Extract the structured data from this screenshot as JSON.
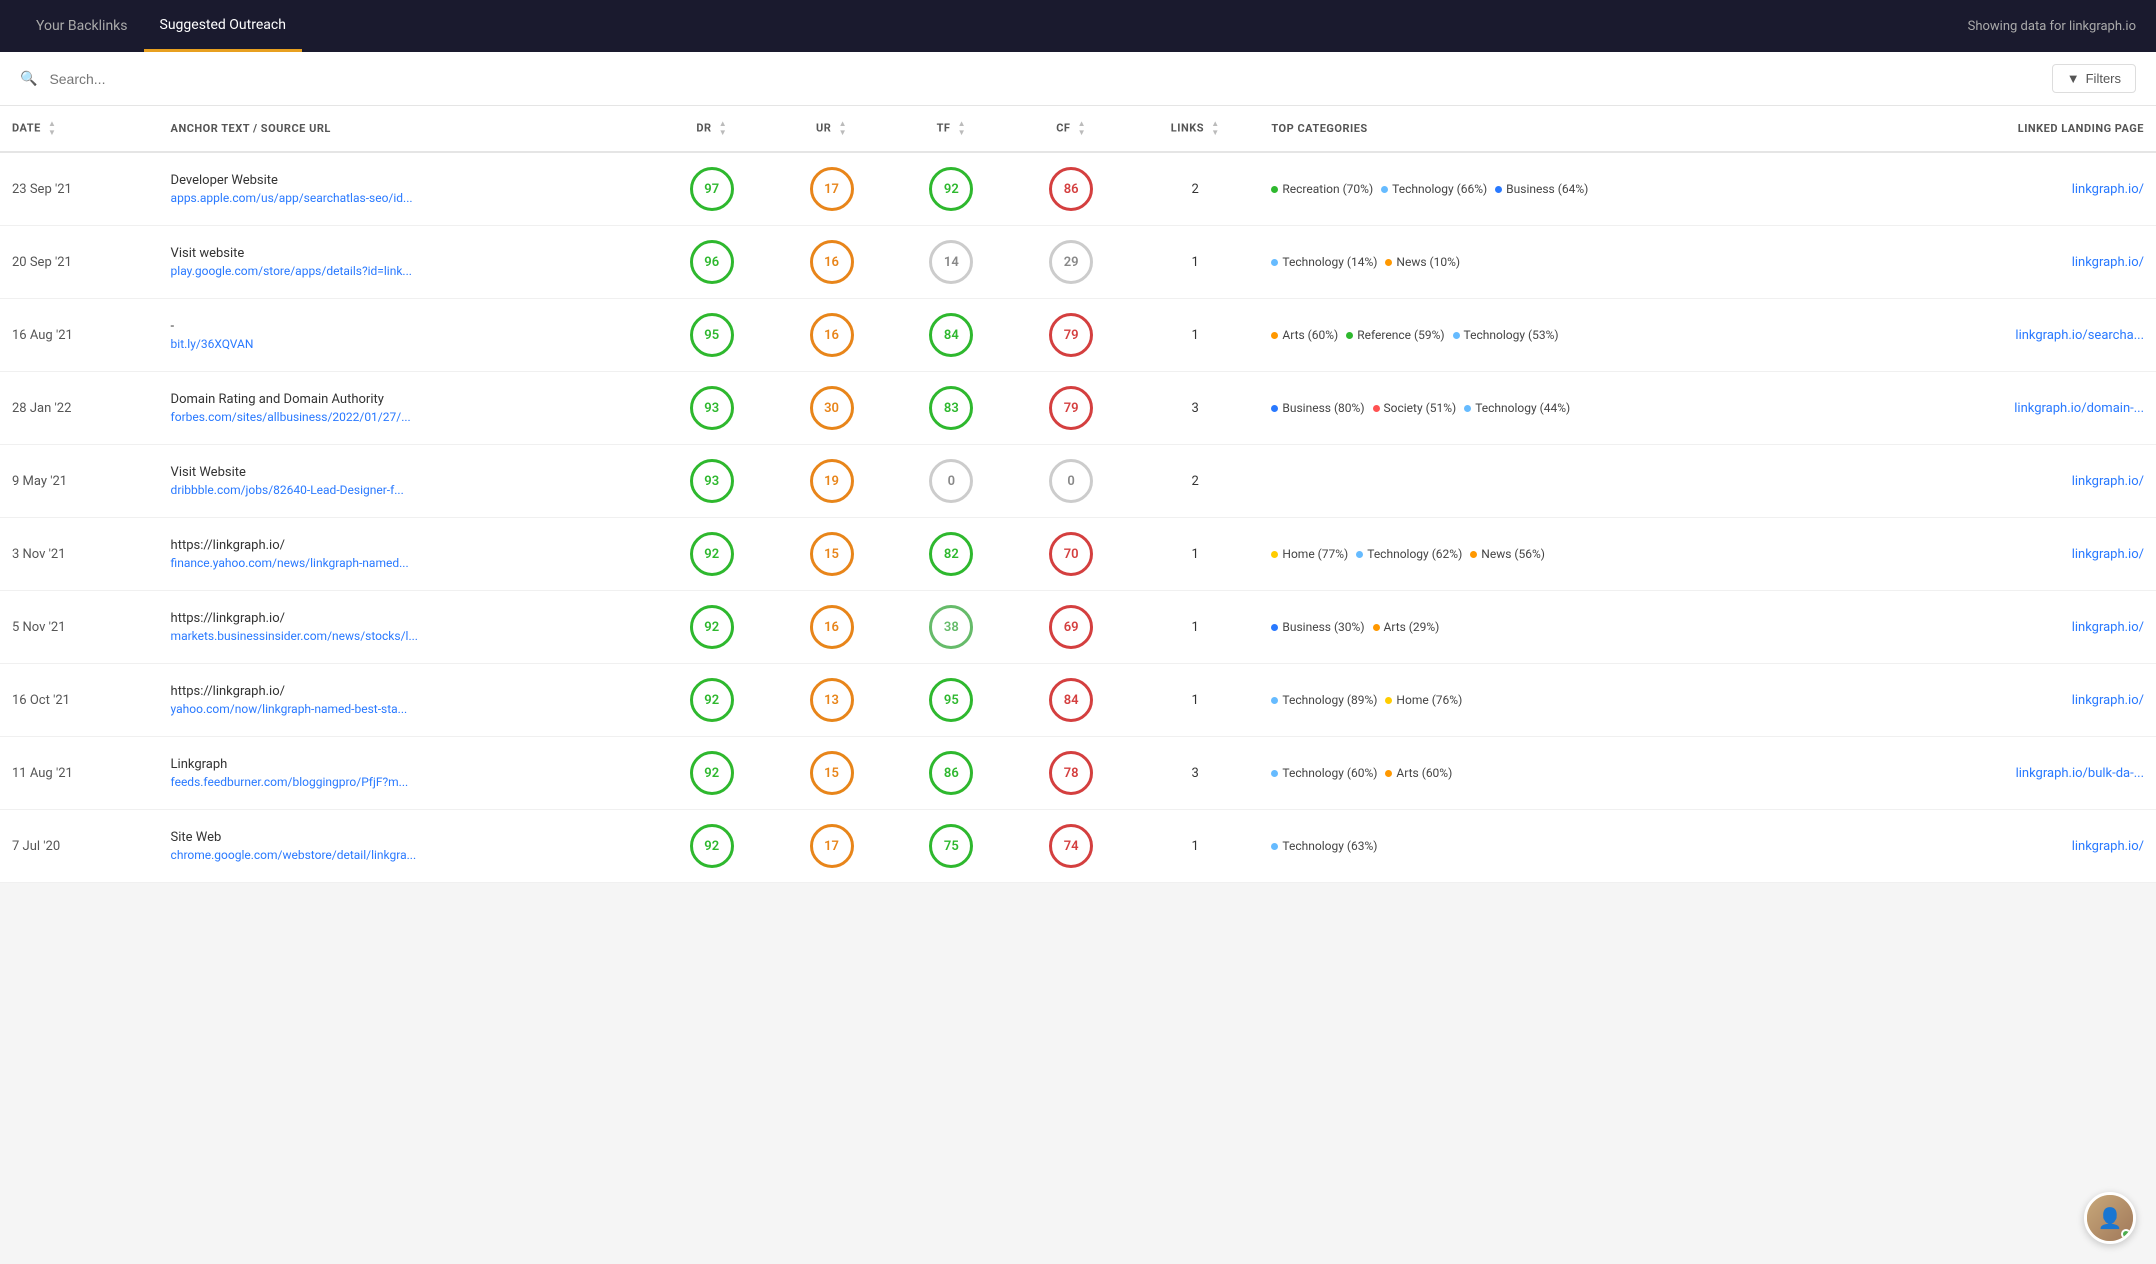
{
  "nav": {
    "tabs": [
      {
        "id": "your-backlinks",
        "label": "Your Backlinks",
        "active": false
      },
      {
        "id": "suggested-outreach",
        "label": "Suggested Outreach",
        "active": true
      }
    ],
    "showing_data": "Showing data for linkgraph.io"
  },
  "search": {
    "placeholder": "Search...",
    "filters_label": "Filters"
  },
  "table": {
    "columns": [
      {
        "id": "date",
        "label": "DATE"
      },
      {
        "id": "anchor",
        "label": "ANCHOR TEXT / SOURCE URL"
      },
      {
        "id": "dr",
        "label": "DR"
      },
      {
        "id": "ur",
        "label": "UR"
      },
      {
        "id": "tf",
        "label": "TF"
      },
      {
        "id": "cf",
        "label": "CF"
      },
      {
        "id": "links",
        "label": "LINKS"
      },
      {
        "id": "top_categories",
        "label": "TOP CATEGORIES"
      },
      {
        "id": "landing_page",
        "label": "LINKED LANDING PAGE"
      }
    ],
    "rows": [
      {
        "date": "23 Sep '21",
        "anchor_title": "Developer Website",
        "anchor_url": "apps.apple.com/us/app/searchatlas-seo/id...",
        "dr": {
          "value": 97,
          "style": "green"
        },
        "ur": {
          "value": 17,
          "style": "orange"
        },
        "tf": {
          "value": 92,
          "style": "green"
        },
        "cf": {
          "value": 86,
          "style": "red"
        },
        "links": 2,
        "categories": [
          {
            "label": "Recreation (70%)",
            "color": "#2eb82e"
          },
          {
            "label": "Technology (66%)",
            "color": "#66bbff"
          },
          {
            "label": "Business (64%)",
            "color": "#2979ff"
          }
        ],
        "landing_page": "linkgraph.io/"
      },
      {
        "date": "20 Sep '21",
        "anchor_title": "Visit website",
        "anchor_url": "play.google.com/store/apps/details?id=link...",
        "dr": {
          "value": 96,
          "style": "green"
        },
        "ur": {
          "value": 16,
          "style": "orange"
        },
        "tf": {
          "value": 14,
          "style": "gray"
        },
        "cf": {
          "value": 29,
          "style": "gray"
        },
        "links": 1,
        "categories": [
          {
            "label": "Technology (14%)",
            "color": "#66bbff"
          },
          {
            "label": "News (10%)",
            "color": "#ff9800"
          }
        ],
        "landing_page": "linkgraph.io/"
      },
      {
        "date": "16 Aug '21",
        "anchor_title": "-",
        "anchor_url": "bit.ly/36XQVAN",
        "dr": {
          "value": 95,
          "style": "green"
        },
        "ur": {
          "value": 16,
          "style": "orange"
        },
        "tf": {
          "value": 84,
          "style": "green"
        },
        "cf": {
          "value": 79,
          "style": "red"
        },
        "links": 1,
        "categories": [
          {
            "label": "Arts (60%)",
            "color": "#ff9800"
          },
          {
            "label": "Reference (59%)",
            "color": "#2eb82e"
          },
          {
            "label": "Technology (53%)",
            "color": "#66bbff"
          }
        ],
        "landing_page": "linkgraph.io/searcha..."
      },
      {
        "date": "28 Jan '22",
        "anchor_title": "Domain Rating and Domain Authority",
        "anchor_url": "forbes.com/sites/allbusiness/2022/01/27/...",
        "dr": {
          "value": 93,
          "style": "green"
        },
        "ur": {
          "value": 30,
          "style": "orange"
        },
        "tf": {
          "value": 83,
          "style": "green"
        },
        "cf": {
          "value": 79,
          "style": "red"
        },
        "links": 3,
        "categories": [
          {
            "label": "Business (80%)",
            "color": "#2979ff"
          },
          {
            "label": "Society (51%)",
            "color": "#ff5252"
          },
          {
            "label": "Technology (44%)",
            "color": "#66bbff"
          }
        ],
        "landing_page": "linkgraph.io/domain-..."
      },
      {
        "date": "9 May '21",
        "anchor_title": "Visit Website",
        "anchor_url": "dribbble.com/jobs/82640-Lead-Designer-f...",
        "dr": {
          "value": 93,
          "style": "green"
        },
        "ur": {
          "value": 19,
          "style": "orange"
        },
        "tf": {
          "value": 0,
          "style": "gray"
        },
        "cf": {
          "value": 0,
          "style": "gray"
        },
        "links": 2,
        "categories": [],
        "landing_page": "linkgraph.io/"
      },
      {
        "date": "3 Nov '21",
        "anchor_title": "https://linkgraph.io/",
        "anchor_url": "finance.yahoo.com/news/linkgraph-named...",
        "dr": {
          "value": 92,
          "style": "green"
        },
        "ur": {
          "value": 15,
          "style": "orange"
        },
        "tf": {
          "value": 82,
          "style": "green"
        },
        "cf": {
          "value": 70,
          "style": "red"
        },
        "links": 1,
        "categories": [
          {
            "label": "Home (77%)",
            "color": "#ffcc00"
          },
          {
            "label": "Technology (62%)",
            "color": "#66bbff"
          },
          {
            "label": "News (56%)",
            "color": "#ff9800"
          }
        ],
        "landing_page": "linkgraph.io/"
      },
      {
        "date": "5 Nov '21",
        "anchor_title": "https://linkgraph.io/",
        "anchor_url": "markets.businessinsider.com/news/stocks/l...",
        "dr": {
          "value": 92,
          "style": "green"
        },
        "ur": {
          "value": 16,
          "style": "orange"
        },
        "tf": {
          "value": 38,
          "style": "light-green"
        },
        "cf": {
          "value": 69,
          "style": "red"
        },
        "links": 1,
        "categories": [
          {
            "label": "Business (30%)",
            "color": "#2979ff"
          },
          {
            "label": "Arts (29%)",
            "color": "#ff9800"
          }
        ],
        "landing_page": "linkgraph.io/"
      },
      {
        "date": "16 Oct '21",
        "anchor_title": "https://linkgraph.io/",
        "anchor_url": "yahoo.com/now/linkgraph-named-best-sta...",
        "dr": {
          "value": 92,
          "style": "green"
        },
        "ur": {
          "value": 13,
          "style": "orange"
        },
        "tf": {
          "value": 95,
          "style": "green"
        },
        "cf": {
          "value": 84,
          "style": "red"
        },
        "links": 1,
        "categories": [
          {
            "label": "Technology (89%)",
            "color": "#66bbff"
          },
          {
            "label": "Home (76%)",
            "color": "#ffcc00"
          }
        ],
        "landing_page": "linkgraph.io/"
      },
      {
        "date": "11 Aug '21",
        "anchor_title": "Linkgraph",
        "anchor_url": "feeds.feedburner.com/bloggingpro/PfjF?m...",
        "dr": {
          "value": 92,
          "style": "green"
        },
        "ur": {
          "value": 15,
          "style": "orange"
        },
        "tf": {
          "value": 86,
          "style": "green"
        },
        "cf": {
          "value": 78,
          "style": "red"
        },
        "links": 3,
        "categories": [
          {
            "label": "Technology (60%)",
            "color": "#66bbff"
          },
          {
            "label": "Arts (60%)",
            "color": "#ff9800"
          }
        ],
        "landing_page": "linkgraph.io/bulk-da-..."
      },
      {
        "date": "7 Jul '20",
        "anchor_title": "Site Web",
        "anchor_url": "chrome.google.com/webstore/detail/linkgra...",
        "dr": {
          "value": 92,
          "style": "green"
        },
        "ur": {
          "value": 17,
          "style": "orange"
        },
        "tf": {
          "value": 75,
          "style": "green"
        },
        "cf": {
          "value": 74,
          "style": "red"
        },
        "links": 1,
        "categories": [
          {
            "label": "Technology (63%)",
            "color": "#66bbff"
          }
        ],
        "landing_page": "linkgraph.io/"
      }
    ]
  }
}
